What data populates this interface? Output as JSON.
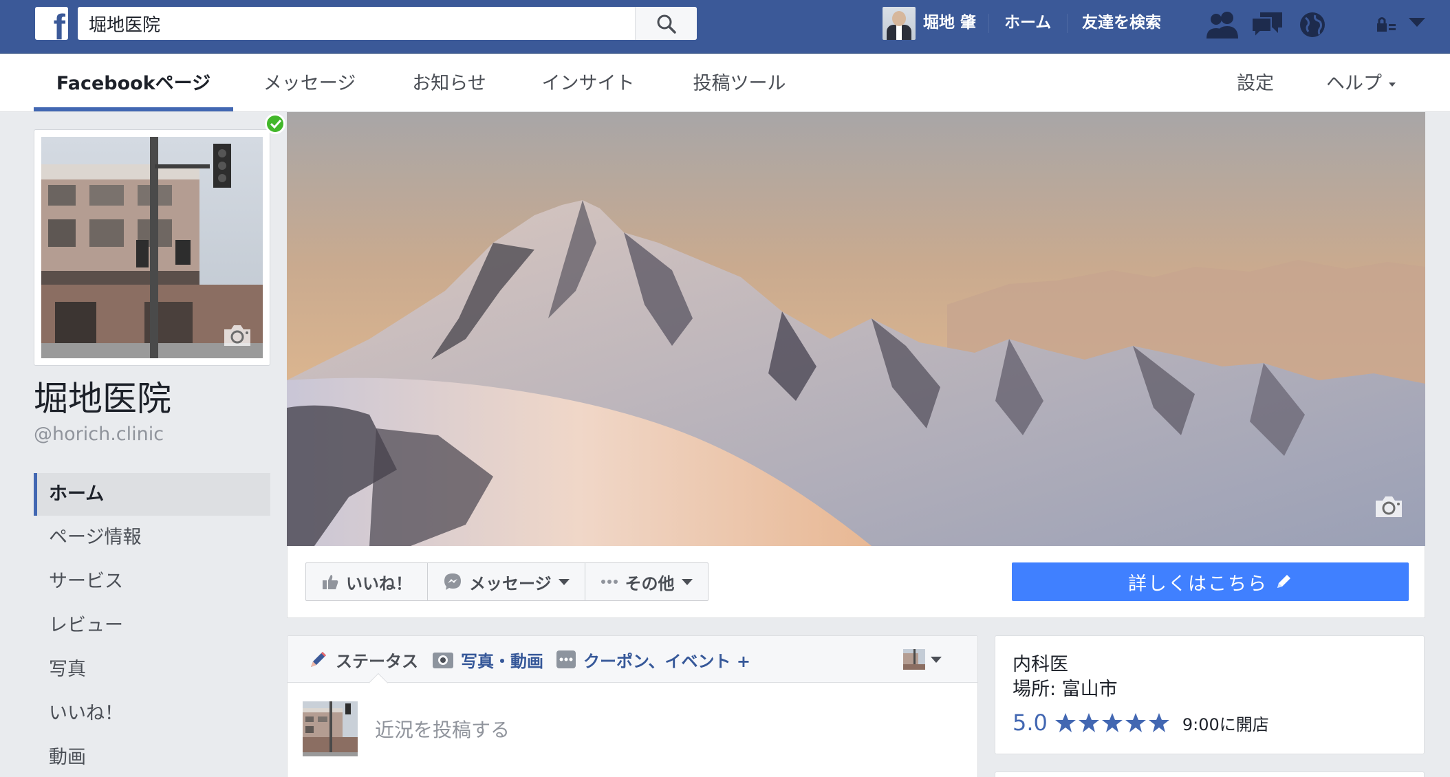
{
  "topbar": {
    "search_value": "堀地医院",
    "user_name": "堀地 肇",
    "home_label": "ホーム",
    "find_friends_label": "友達を検索"
  },
  "page_nav": {
    "tabs": [
      {
        "label": "Facebookページ"
      },
      {
        "label": "メッセージ"
      },
      {
        "label": "お知らせ"
      },
      {
        "label": "インサイト"
      },
      {
        "label": "投稿ツール"
      }
    ],
    "settings_label": "設定",
    "help_label": "ヘルプ"
  },
  "profile": {
    "name": "堀地医院",
    "handle": "@horich.clinic"
  },
  "sidebar": {
    "items": [
      {
        "label": "ホーム"
      },
      {
        "label": "ページ情報"
      },
      {
        "label": "サービス"
      },
      {
        "label": "レビュー"
      },
      {
        "label": "写真"
      },
      {
        "label": "いいね！"
      },
      {
        "label": "動画"
      }
    ]
  },
  "actions": {
    "like_label": "いいね！",
    "message_label": "メッセージ",
    "more_label": "その他",
    "cta_label": "詳しくはこちら"
  },
  "composer": {
    "tab_status": "ステータス",
    "tab_photo": "写真・動画",
    "tab_offer": "クーポン、イベント +",
    "placeholder": "近況を投稿する"
  },
  "info": {
    "category": "内科医",
    "location": "場所: 富山市",
    "rating": "5.0",
    "stars": 5,
    "hours": "9:00に開店"
  },
  "colors": {
    "brand_blue": "#3b5998",
    "cta_blue": "#4080ff",
    "verified_green": "#42b72a"
  }
}
